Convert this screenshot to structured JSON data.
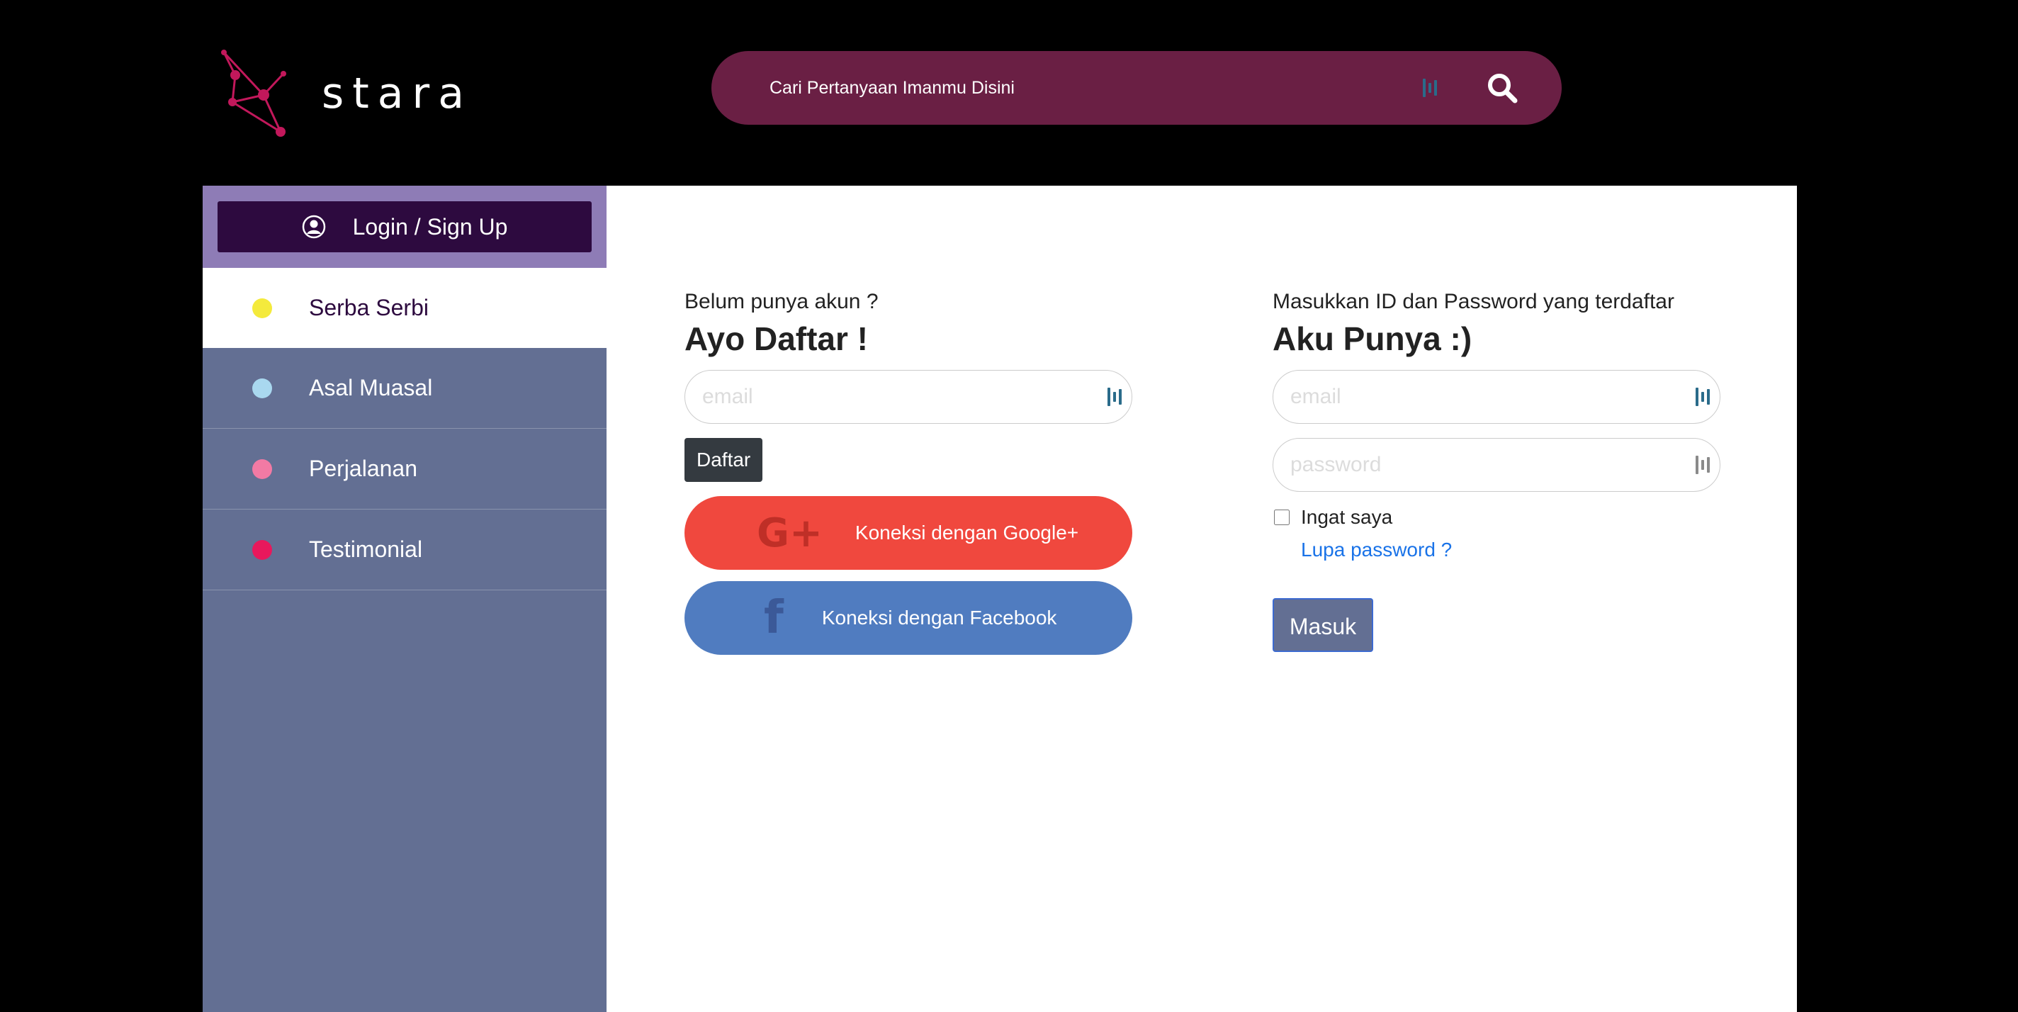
{
  "brand": {
    "name": "stara"
  },
  "search": {
    "placeholder": "Cari Pertanyaan Imanmu Disini"
  },
  "sidebar": {
    "login_label": "Login / Sign Up",
    "items": [
      {
        "label": "Serba Serbi",
        "color": "#f4ea3c",
        "active": true
      },
      {
        "label": "Asal Muasal",
        "color": "#a9d8ef",
        "active": false
      },
      {
        "label": "Perjalanan",
        "color": "#f27aa4",
        "active": false
      },
      {
        "label": "Testimonial",
        "color": "#e8185c",
        "active": false
      }
    ]
  },
  "register": {
    "subtitle": "Belum punya akun ?",
    "title": "Ayo Daftar !",
    "email_placeholder": "email",
    "submit_label": "Daftar",
    "google_label": "Koneksi dengan Google+",
    "facebook_label": "Koneksi dengan Facebook",
    "google_icon": "G+",
    "facebook_icon": "f"
  },
  "login": {
    "subtitle": "Masukkan ID dan Password yang terdaftar",
    "title": "Aku Punya :)",
    "email_placeholder": "email",
    "password_placeholder": "password",
    "remember_label": "Ingat saya",
    "forgot_label": "Lupa password ?",
    "submit_label": "Masuk"
  }
}
